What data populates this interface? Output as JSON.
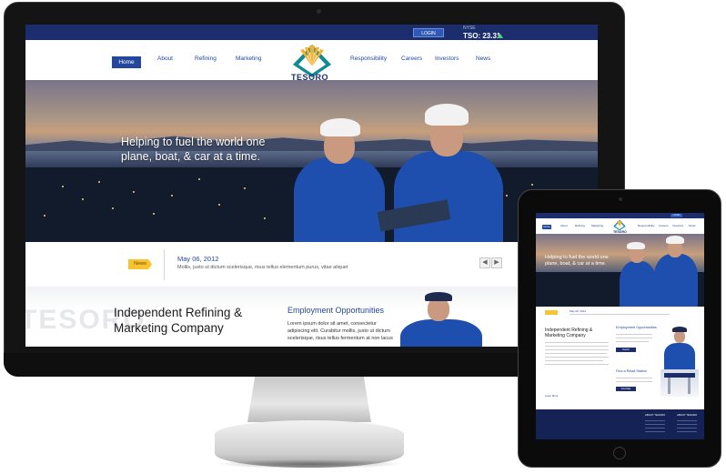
{
  "topbar": {
    "login_label": "LOGIN",
    "stock_exchange": "NYSE",
    "stock_value": "TSO: 23.31",
    "stock_trend": "up"
  },
  "logo": {
    "text": "TESORO"
  },
  "nav": {
    "items": [
      "Home",
      "About",
      "Refining",
      "Marketing",
      "Responsibility",
      "Careers",
      "Investors",
      "News"
    ],
    "active": "Home"
  },
  "hero": {
    "headline": "Helping to fuel the world one plane, boat, & car at a time."
  },
  "news": {
    "tag": "News",
    "date": "May 06, 2012",
    "text": "Mollis, justo ut dictum scelerisque, risus tellus elementum purus, vitae aliquet",
    "prev": "◀",
    "next": "▶"
  },
  "content": {
    "watermark": "TESORO",
    "company_title": "Independent Refining & Marketing Company",
    "employment_title": "Employment Opportunities",
    "employment_text": "Lorem ipsum dolor sit amet, consectetur adipiscing elit. Curabitur mollis, justo ut dictum scelerisque, risus tellus fermentum at non lacus"
  },
  "tablet": {
    "login_label": "LOGIN",
    "stock": "TSO: 23.31",
    "logo_text": "TESORO",
    "nav_items": [
      "Home",
      "About",
      "Refining",
      "Marketing",
      "Responsibility",
      "Careers",
      "Investors",
      "News"
    ],
    "headline": "Helping to fuel the world one plane, boat, & car at a time.",
    "news_date": "May 06, 2012",
    "company_title": "Independent Refining & Marketing Company",
    "employment_title": "Employment Opportunities",
    "retail_title": "Find a Retail Station",
    "learn_more": "Learn More",
    "search_btn": "Search",
    "find_btn": "Find Map",
    "footer_left": "ABOUT TESORO",
    "footer_right": "ABOUT TESORO"
  },
  "colors": {
    "brand_navy": "#1c2d6d",
    "brand_blue": "#23479d",
    "news_tag": "#f7c331",
    "stock_up": "#46d46b"
  }
}
